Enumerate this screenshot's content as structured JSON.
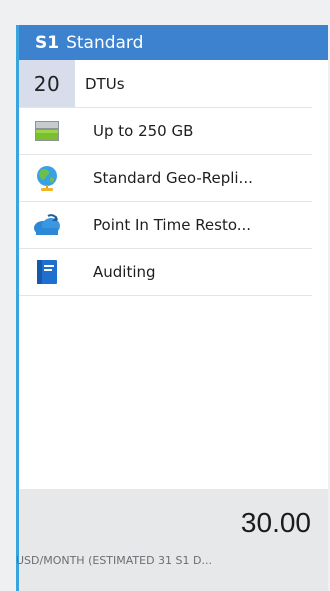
{
  "tile": {
    "tier": "S1",
    "tier_name": "Standard",
    "colors": {
      "header": "#3c82cf",
      "accent_border": "#3aa4df",
      "dtu_badge": "#d7ddea"
    }
  },
  "features": {
    "dtu_value": "20",
    "dtu_label": "DTUs",
    "storage_label": "Up to 250 GB",
    "storage_icon": "storage-disk-icon",
    "geo_label": "Standard Geo-Repli...",
    "geo_icon": "globe-icon",
    "restore_label": "Point In Time Resto...",
    "restore_icon": "cloud-restore-icon",
    "auditing_label": "Auditing",
    "auditing_icon": "auditing-book-icon"
  },
  "pricing": {
    "price": "30.00",
    "caption": "USD/MONTH (ESTIMATED 31 S1 D..."
  }
}
